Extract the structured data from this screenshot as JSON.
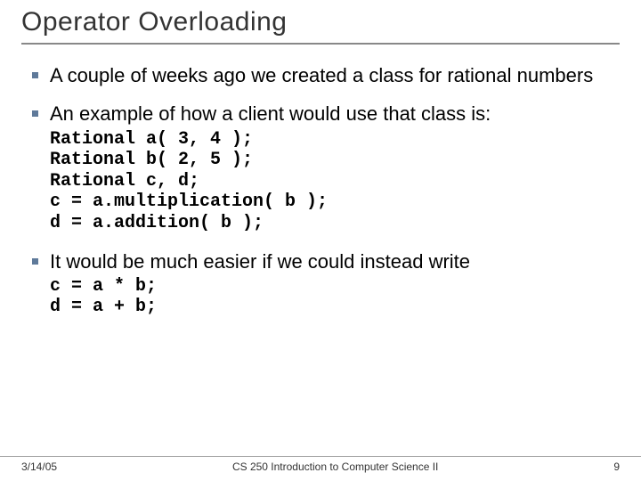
{
  "title": "Operator Overloading",
  "bullets": [
    {
      "text": "A couple of weeks ago we created a class for rational numbers"
    },
    {
      "text": "An example of how a client would use that class is:",
      "code": "Rational a( 3, 4 );\nRational b( 2, 5 );\nRational c, d;\nc = a.multiplication( b );\nd = a.addition( b );"
    },
    {
      "text": "It would be much easier if we could instead write",
      "code": "c = a * b;\nd = a + b;"
    }
  ],
  "footer": {
    "date": "3/14/05",
    "course": "CS 250 Introduction to Computer Science II",
    "page": "9"
  }
}
